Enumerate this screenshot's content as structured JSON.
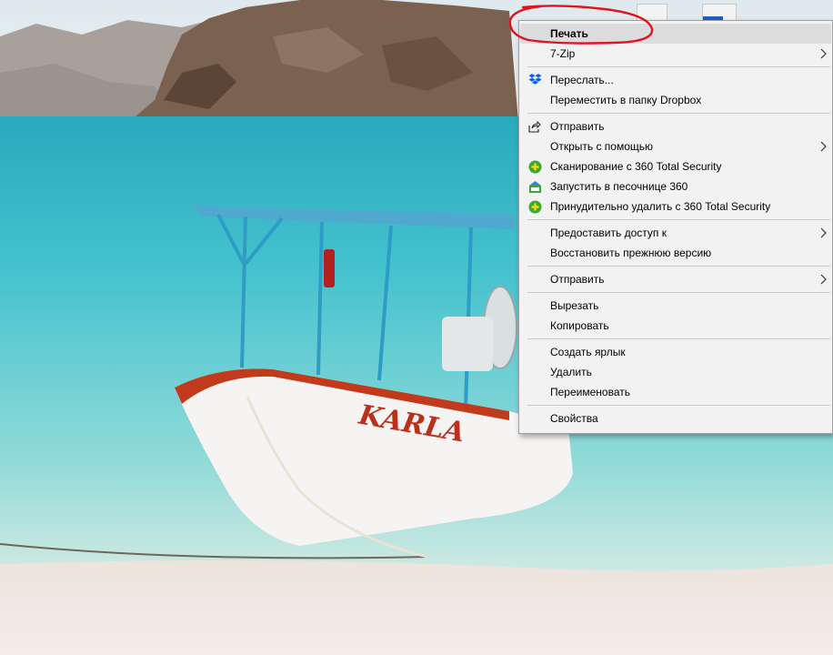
{
  "context_menu": {
    "items": [
      {
        "label": "Печать",
        "bold": true,
        "highlighted": true
      },
      {
        "label": "7-Zip",
        "submenu": true
      },
      {
        "label": "Переслать...",
        "icon": "dropbox-icon"
      },
      {
        "label": "Переместить в папку Dropbox"
      },
      {
        "label": "Отправить",
        "icon": "share-icon"
      },
      {
        "label": "Открыть с помощью",
        "submenu": true
      },
      {
        "label": "Сканирование с 360 Total Security",
        "icon": "360-total-security-icon"
      },
      {
        "label": "Запустить в песочнице 360",
        "icon": "sandbox-icon"
      },
      {
        "label": "Принудительно удалить с  360 Total Security",
        "icon": "360-total-security-icon"
      },
      {
        "label": "Предоставить доступ к",
        "submenu": true
      },
      {
        "label": "Восстановить прежнюю версию"
      },
      {
        "label": "Отправить",
        "submenu": true
      },
      {
        "label": "Вырезать"
      },
      {
        "label": "Копировать"
      },
      {
        "label": "Создать ярлык"
      },
      {
        "label": "Удалить"
      },
      {
        "label": "Переименовать"
      },
      {
        "label": "Свойства"
      }
    ]
  },
  "wallpaper": {
    "boat_name": "KARLA"
  },
  "colors": {
    "menu_background": "#f2f2f2",
    "menu_highlight": "#dcdcdc",
    "annotation_red": "#e0141e",
    "dropbox_blue": "#0061ff",
    "security_green": "#3aa832"
  }
}
